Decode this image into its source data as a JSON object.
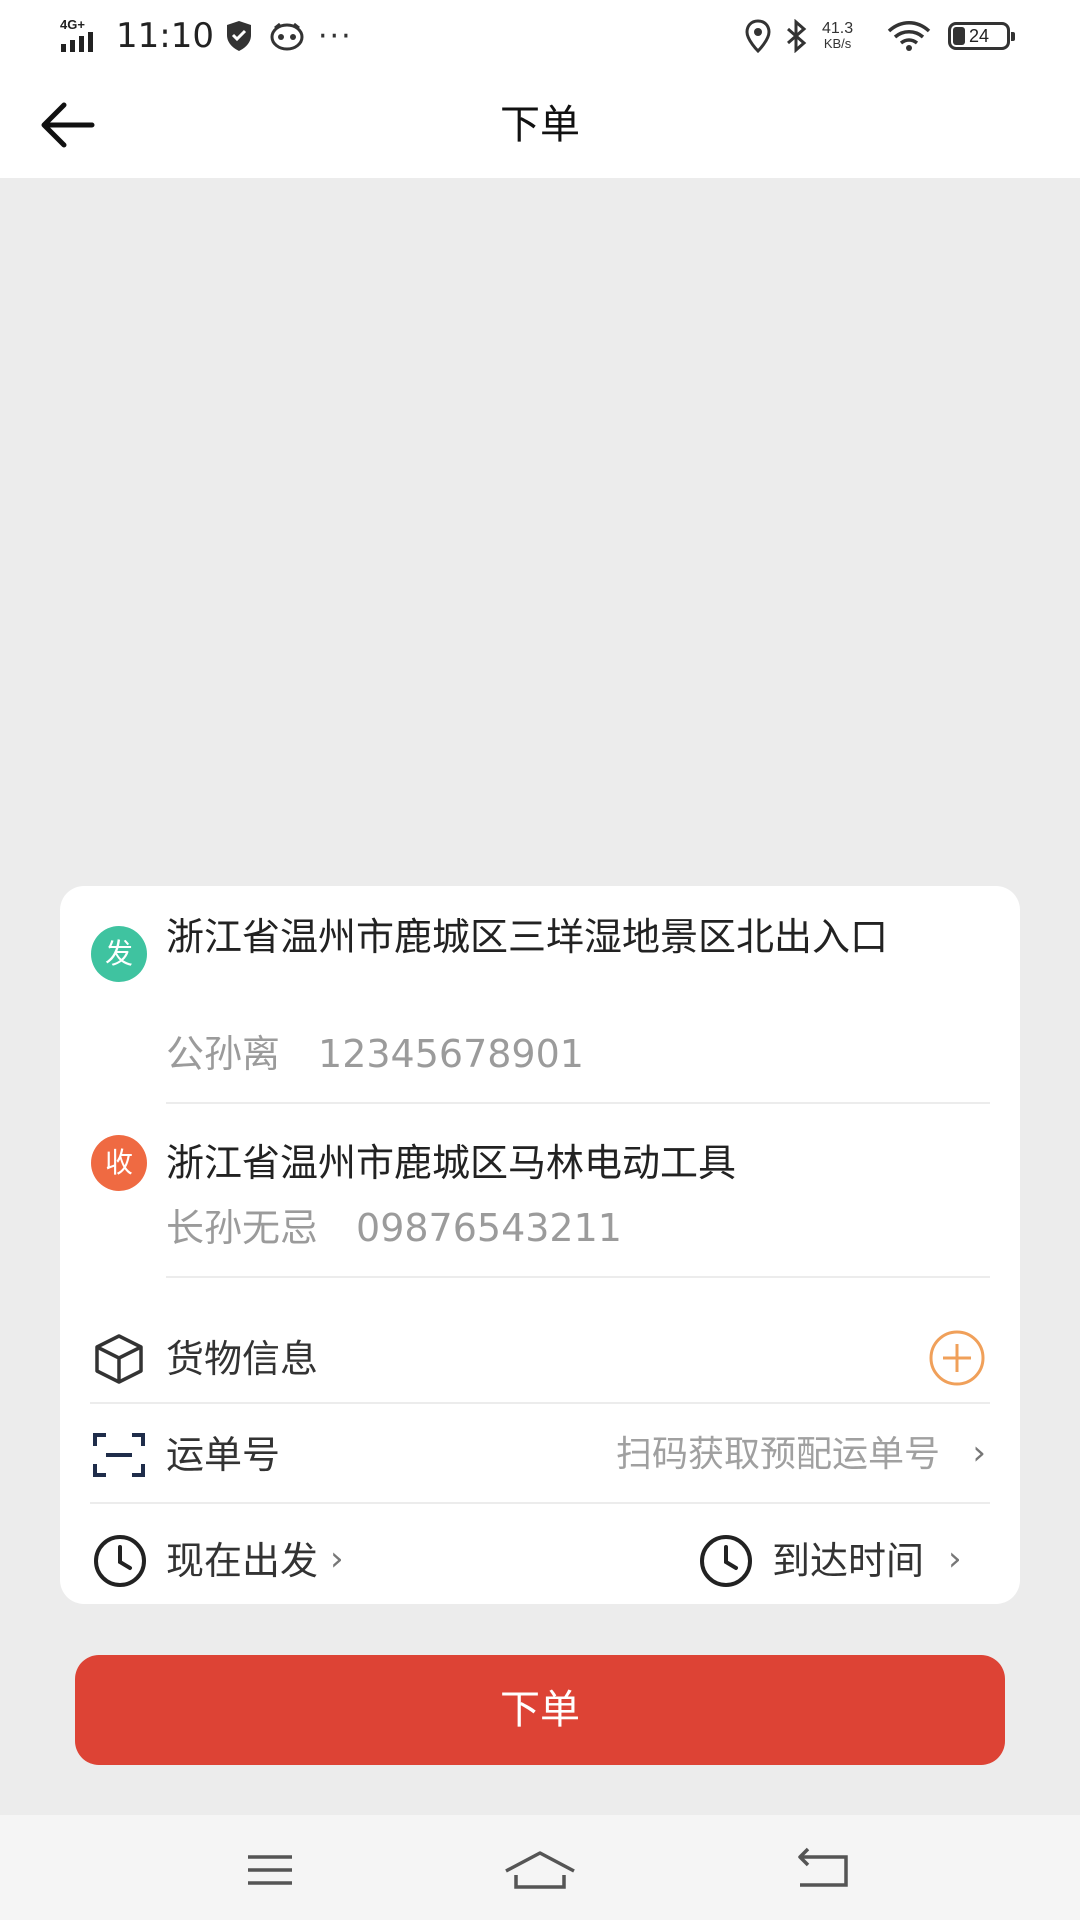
{
  "status_bar": {
    "network": "4G+",
    "time": "11:10",
    "more": "···",
    "speed_value": "41.3",
    "speed_unit": "KB/s",
    "battery": "24"
  },
  "nav": {
    "title": "下单"
  },
  "sender": {
    "badge": "发",
    "address": "浙江省温州市鹿城区三垟湿地景区北出入口",
    "name": "公孙离",
    "phone": "12345678901"
  },
  "receiver": {
    "badge": "收",
    "address": "浙江省温州市鹿城区马林电动工具",
    "name": "长孙无忌",
    "phone": "09876543211"
  },
  "cargo": {
    "label": "货物信息"
  },
  "waybill": {
    "label": "运单号",
    "hint": "扫码获取预配运单号"
  },
  "schedule": {
    "depart_label": "现在出发",
    "arrive_label": "到达时间"
  },
  "submit": {
    "label": "下单"
  },
  "colors": {
    "accent_red": "#dd4335",
    "send_badge": "#3fc3a0",
    "recv_badge": "#ef6a42",
    "add_orange": "#f0a05a"
  },
  "icons": [
    "back-arrow-icon",
    "box-icon",
    "scan-icon",
    "clock-icon",
    "plus-circle-icon",
    "chevron-right-icon"
  ]
}
